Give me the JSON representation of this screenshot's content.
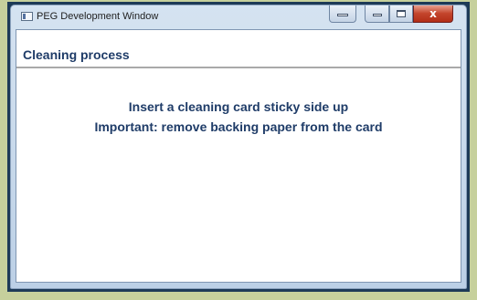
{
  "window": {
    "title": "PEG Development Window",
    "title_icon": "app-window-icon",
    "buttons": {
      "extra_icon": "dock-icon",
      "minimize_icon": "minimize-icon",
      "maximize_icon": "maximize-icon",
      "close_icon": "close-icon",
      "close_glyph": "x"
    }
  },
  "screen": {
    "title": "Cleaning process",
    "instructions": [
      "Insert a cleaning card sticky side up",
      "Important: remove backing paper from the card"
    ]
  },
  "colors": {
    "background": "#c6d09c",
    "frame": "#1d3a57",
    "text": "#1f3c68",
    "close_button": "#c4452c"
  }
}
